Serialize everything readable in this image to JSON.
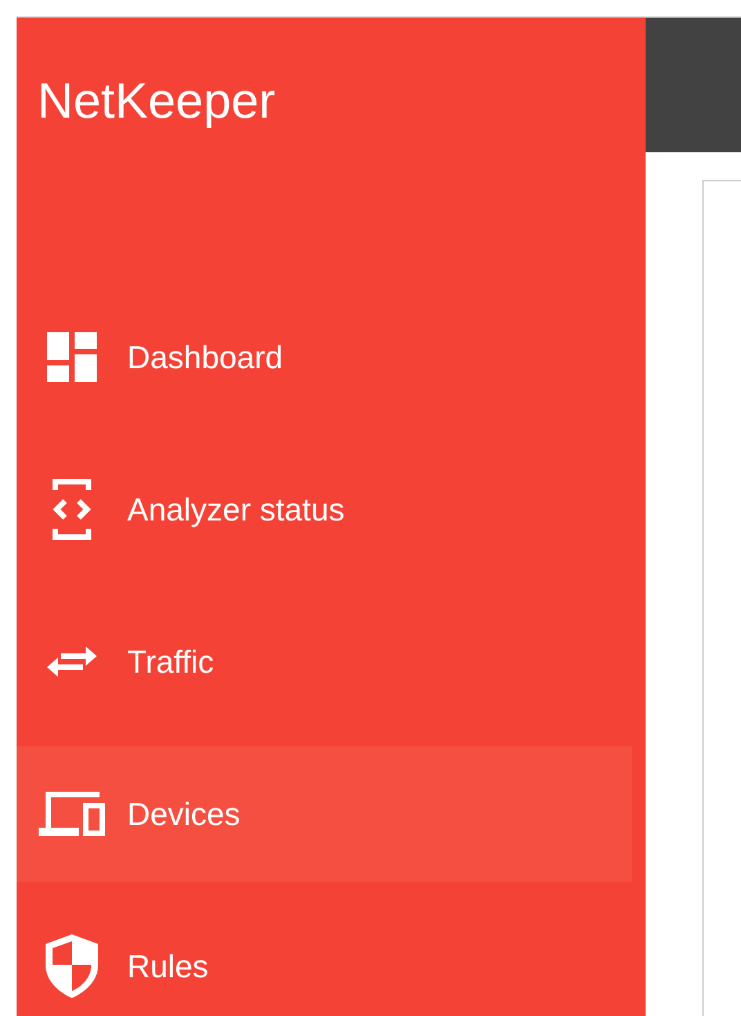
{
  "app": {
    "title": "NetKeeper"
  },
  "sidebar": {
    "items": [
      {
        "label": "Dashboard",
        "kind": "dashboard",
        "selected": false
      },
      {
        "label": "Analyzer status",
        "kind": "analyzer",
        "selected": false
      },
      {
        "label": "Traffic",
        "kind": "traffic",
        "selected": false
      },
      {
        "label": "Devices",
        "kind": "devices",
        "selected": true
      },
      {
        "label": "Rules",
        "kind": "rules",
        "selected": false
      }
    ]
  }
}
